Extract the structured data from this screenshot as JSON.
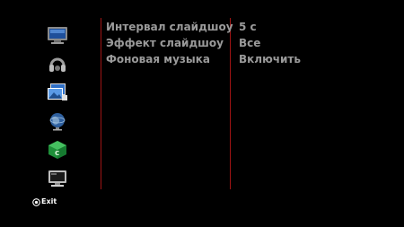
{
  "menu": {
    "items": [
      {
        "icon": "tv-screen-icon",
        "selected": false
      },
      {
        "icon": "music-headphones-icon",
        "selected": false
      },
      {
        "icon": "photo-slides-icon",
        "selected": true
      },
      {
        "icon": "network-globe-icon",
        "selected": false
      },
      {
        "icon": "green-cube-icon",
        "selected": false
      },
      {
        "icon": "system-monitor-icon",
        "selected": false
      }
    ]
  },
  "settings": [
    {
      "label": "Интервал слайдшоу",
      "value": "5 с"
    },
    {
      "label": "Эффект слайдшоу",
      "value": "Все"
    },
    {
      "label": "Фоновая музыка",
      "value": "Включить"
    }
  ],
  "footer": {
    "exit_label": "Exit"
  },
  "colors": {
    "background": "#000000",
    "divider": "#a01414",
    "text": "#9a9a9a",
    "exit_text": "#ffffff"
  }
}
